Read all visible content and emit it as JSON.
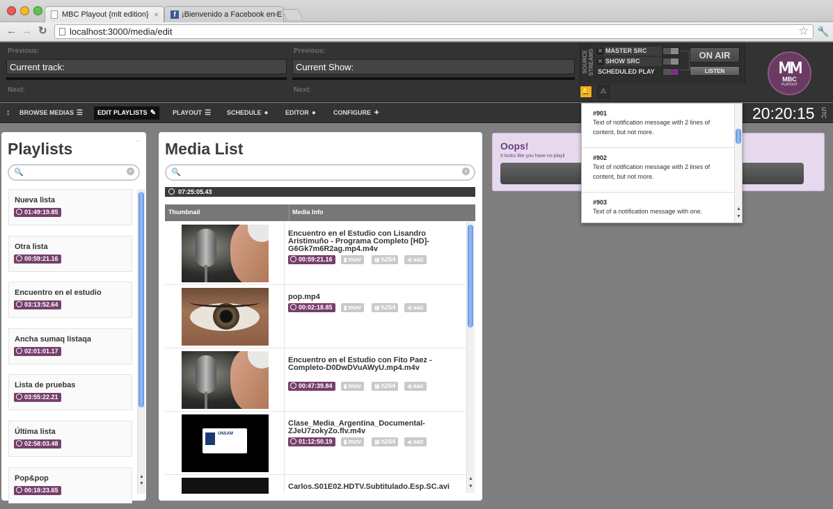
{
  "browser": {
    "tabs": [
      {
        "label": "MBC Playout {mlt edition}"
      },
      {
        "label": "¡Bienvenido a Facebook en E"
      }
    ],
    "url": "localhost:3000/media/edit"
  },
  "header": {
    "previous_label": "Previous:",
    "current_track_label": "Current track:",
    "next_label": "Next:",
    "current_show_label": "Current Show:",
    "source_streams_label": "SOURCE STREAMS",
    "sources": [
      "MASTER SRC",
      "SHOW SRC",
      "SCHEDULED PLAY"
    ],
    "on_air_label": "ON AIR",
    "listen_label": "LISTEN",
    "logo_text": "MBC",
    "logo_sub": "PLAYOUT"
  },
  "menu": {
    "items": [
      "BROWSE MEDIAS",
      "EDIT PLAYLISTS",
      "PLAYOUT",
      "SCHEDULE",
      "EDITOR",
      "CONFIGURE"
    ],
    "active": "EDIT PLAYLISTS"
  },
  "clock": {
    "time": "20:20:15",
    "zone": "UTC"
  },
  "playlists": {
    "title": "Playlists",
    "search_placeholder": "",
    "items": [
      {
        "name": "Nueva lista",
        "duration": "01:49:19.85"
      },
      {
        "name": "Otra lista",
        "duration": "00:59:21.16"
      },
      {
        "name": "Encuentro en el estudio",
        "duration": "03:13:52.64"
      },
      {
        "name": "Ancha sumaq listaqa",
        "duration": "02:01:01.17"
      },
      {
        "name": "Lista de pruebas",
        "duration": "03:55:22.21"
      },
      {
        "name": "Última lista",
        "duration": "02:58:03.48"
      },
      {
        "name": "Pop&pop",
        "duration": "00:18:23.65"
      }
    ]
  },
  "media_list": {
    "title": "Media List",
    "search_placeholder": "",
    "total_duration": "07:25:05.43",
    "columns": [
      "Thumbnail",
      "Media Info"
    ],
    "items": [
      {
        "title": "Encuentro en el Estudio con Lisandro Aristimuño - Programa Completo [HD]-G6Gk7m6R2ag.mp4.m4v",
        "duration": "00:59:21.16",
        "format": "mov",
        "video": "h264",
        "audio": "aac",
        "thumb": "microphone"
      },
      {
        "title": "pop.mp4",
        "duration": "00:02:18.85",
        "format": "mov",
        "video": "h264",
        "audio": "aac",
        "thumb": "eye"
      },
      {
        "title": "Encuentro en el Estudio con Fito Paez - Completo-D0DwDVuAWyU.mp4.m4v",
        "duration": "00:47:39.84",
        "format": "mov",
        "video": "h264",
        "audio": "aac",
        "thumb": "microphone"
      },
      {
        "title": "Clase_Media_Argentina_Documental-ZJeU7zokyZo.flv.m4v",
        "duration": "01:12:50.19",
        "format": "mov",
        "video": "h264",
        "audio": "aac",
        "thumb": "unsam"
      },
      {
        "title": "Carlos.S01E02.HDTV.Subtitulado.Esp.SC.avi",
        "thumb": "dark"
      }
    ],
    "unsam_logo_text": "UNSAM"
  },
  "oops": {
    "heading": "Oops!",
    "text": "It looks like you have no playli"
  },
  "notifications": [
    {
      "id": "#901",
      "message": "Text of notification message with 2 lines of content, but not more."
    },
    {
      "id": "#902",
      "message": "Text of notification message with 2 lines of content, but not more."
    },
    {
      "id": "#903",
      "message": "Text of a notification message with one."
    }
  ],
  "colors": {
    "accent_purple": "#763f6b",
    "header_bg": "#333333",
    "notif_yellow": "#f0b01c"
  }
}
